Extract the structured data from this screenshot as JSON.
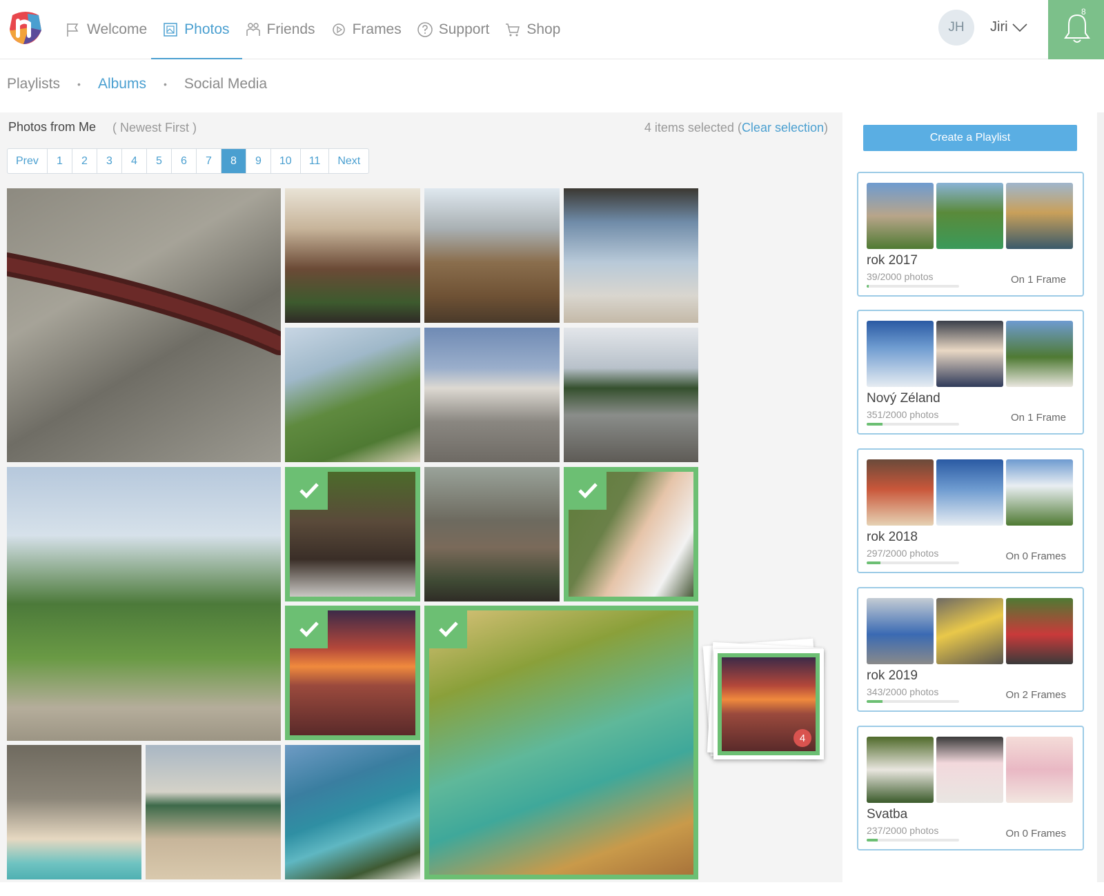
{
  "nav": {
    "items": [
      {
        "label": "Welcome",
        "icon": "flag-icon"
      },
      {
        "label": "Photos",
        "icon": "photo-icon",
        "active": true
      },
      {
        "label": "Friends",
        "icon": "friends-icon"
      },
      {
        "label": "Frames",
        "icon": "frame-icon"
      },
      {
        "label": "Support",
        "icon": "help-icon"
      },
      {
        "label": "Shop",
        "icon": "cart-icon"
      }
    ],
    "user_initials": "JH",
    "user_name": "Jiri",
    "notification_count": "8",
    "accent_color": "#4a9fd0",
    "notification_color": "#7cc08a"
  },
  "subnav": {
    "items": [
      "Playlists",
      "Albums",
      "Social Media"
    ],
    "active": "Albums"
  },
  "album": {
    "title": "Photos from Me",
    "sort": "( Newest First )",
    "selected_text": "4 items selected (",
    "clear_label": "Clear selection",
    "selected_close": ")"
  },
  "pager": {
    "prev": "Prev",
    "pages": [
      "1",
      "2",
      "3",
      "4",
      "5",
      "6",
      "7",
      "8",
      "9",
      "10",
      "11"
    ],
    "active_page": "8",
    "next": "Next"
  },
  "drag_stack": {
    "count": "4"
  },
  "sidebar": {
    "create_label": "Create a Playlist",
    "playlists": [
      {
        "name": "rok 2017",
        "count": "39/2000 photos",
        "frames": "On 1 Frame",
        "progress": 0.02
      },
      {
        "name": "Nový Zéland",
        "count": "351/2000 photos",
        "frames": "On 1 Frame",
        "progress": 0.175
      },
      {
        "name": "rok 2018",
        "count": "297/2000 photos",
        "frames": "On 0 Frames",
        "progress": 0.15
      },
      {
        "name": "rok 2019",
        "count": "343/2000 photos",
        "frames": "On 2 Frames",
        "progress": 0.17
      },
      {
        "name": "Svatba",
        "count": "237/2000 photos",
        "frames": "On 0 Frames",
        "progress": 0.12
      }
    ]
  }
}
